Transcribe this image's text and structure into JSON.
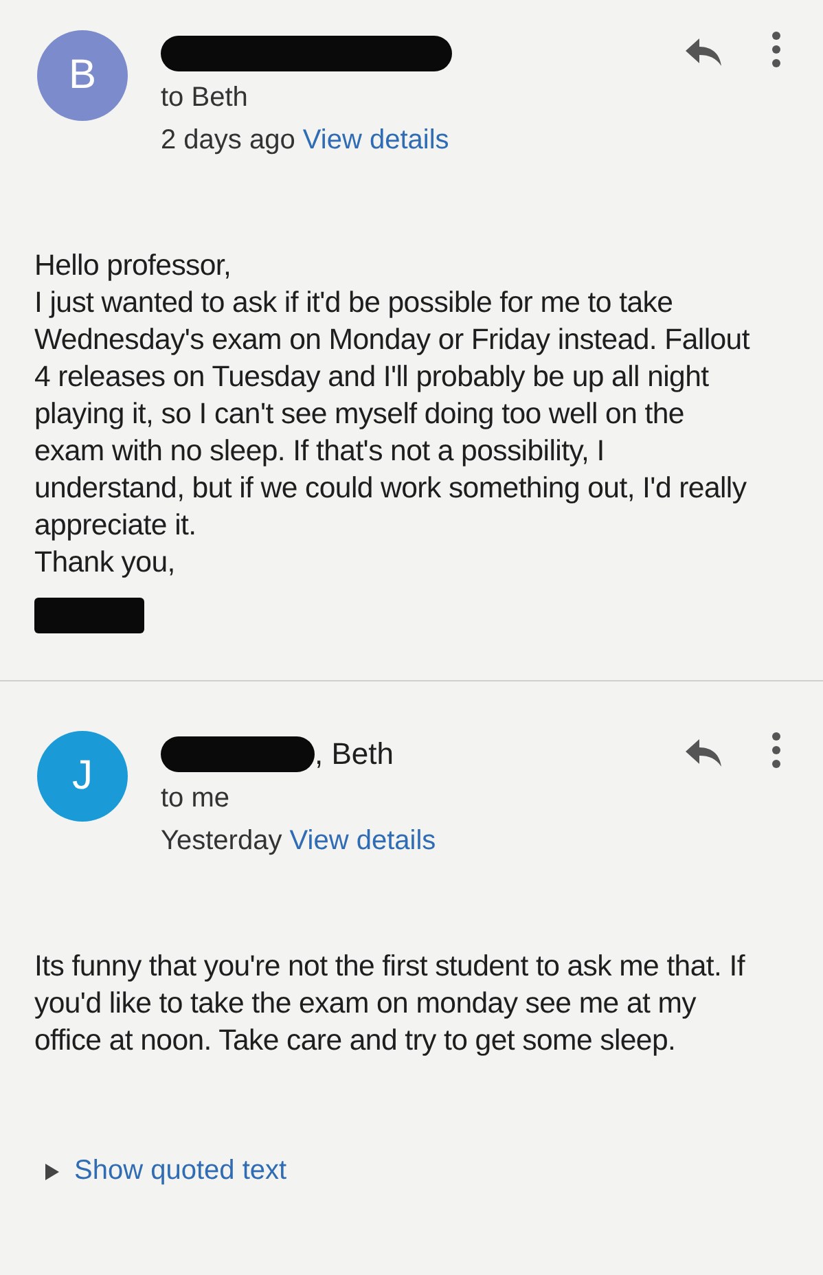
{
  "messages": [
    {
      "avatar_letter": "B",
      "color": "#7c8bcc",
      "sender_redacted": true,
      "recipient": "to Beth",
      "time": "2 days ago",
      "details_link": "View details",
      "paragraphs": [
        "Hello professor,",
        "I just wanted to ask if it'd be possible for me to take Wednesday's exam on Monday or Friday instead. Fallout 4 releases on Tuesday and I'll probably be up all night playing it, so I can't see myself doing too well on the exam with no sleep. If that's not a possibility, I understand, but if we could work something out, I'd really appreciate it.",
        "Thank you,"
      ],
      "signature_redacted": true
    },
    {
      "avatar_letter": "J",
      "color": "#1b9ad8",
      "sender_redacted": true,
      "sender_name": ", Beth",
      "recipient": "to me",
      "time": "Yesterday",
      "details_link": "View details",
      "paragraphs": [
        "Its funny that you're not the first student to ask me that. If you'd like to take the exam on monday see me at my office at noon. Take care and try to get some sleep."
      ],
      "quoted_link": "Show quoted text"
    }
  ]
}
